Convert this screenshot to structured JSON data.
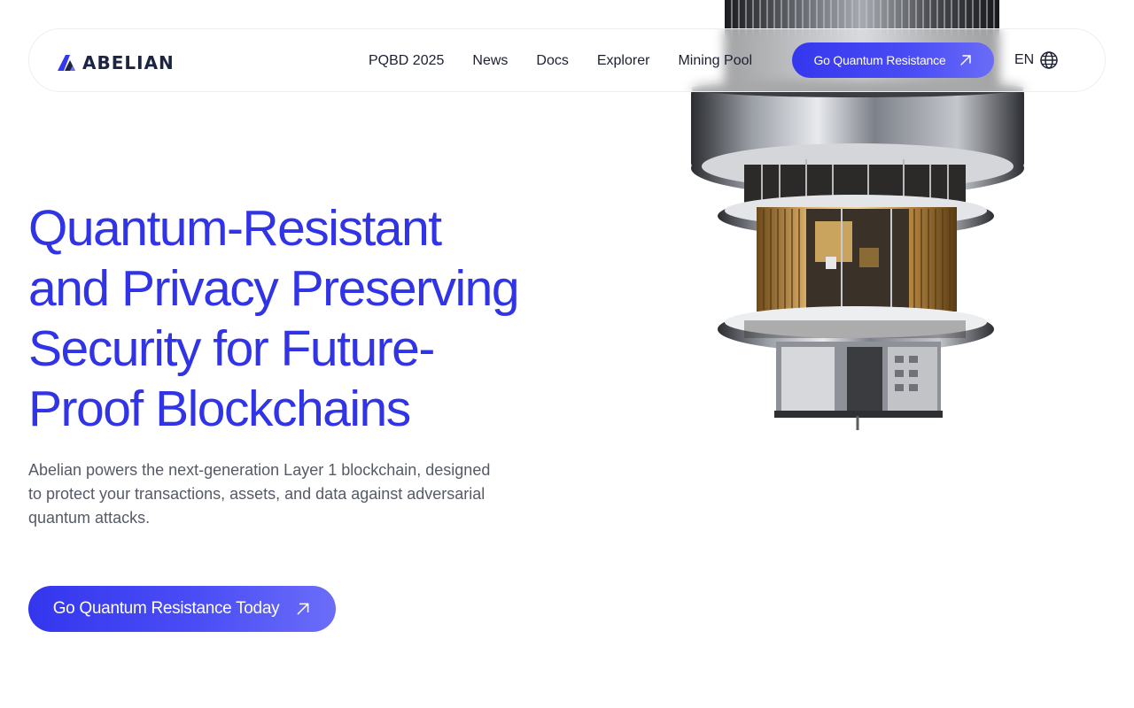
{
  "brand": {
    "name": "ABELIAN",
    "logo_icon": "abelian-logo-icon"
  },
  "nav": {
    "links": [
      "PQBD 2025",
      "News",
      "Docs",
      "Explorer",
      "Mining Pool"
    ],
    "cta_label": "Go Quantum Resistance",
    "cta_icon": "arrow-up-right-icon",
    "language": "EN",
    "language_icon": "globe-icon"
  },
  "hero": {
    "title_lines": [
      "Quantum-Resistant",
      "and Privacy Preserving",
      "Security for Future-",
      "Proof Blockchains"
    ],
    "description_lines": [
      "Abelian powers the next-generation Layer 1 blockchain, designed",
      "to protect your transactions, assets, and data against adversarial",
      "quantum attacks."
    ],
    "cta_label": "Go Quantum Resistance Today",
    "cta_icon": "arrow-up-right-icon",
    "illustration": "quantum-computer-cryostat-image"
  },
  "colors": {
    "accent": "#3537EE",
    "accent_light": "#6B6DF8",
    "title": "#3033E6",
    "text": "#1C2030",
    "muted": "#555A66"
  }
}
